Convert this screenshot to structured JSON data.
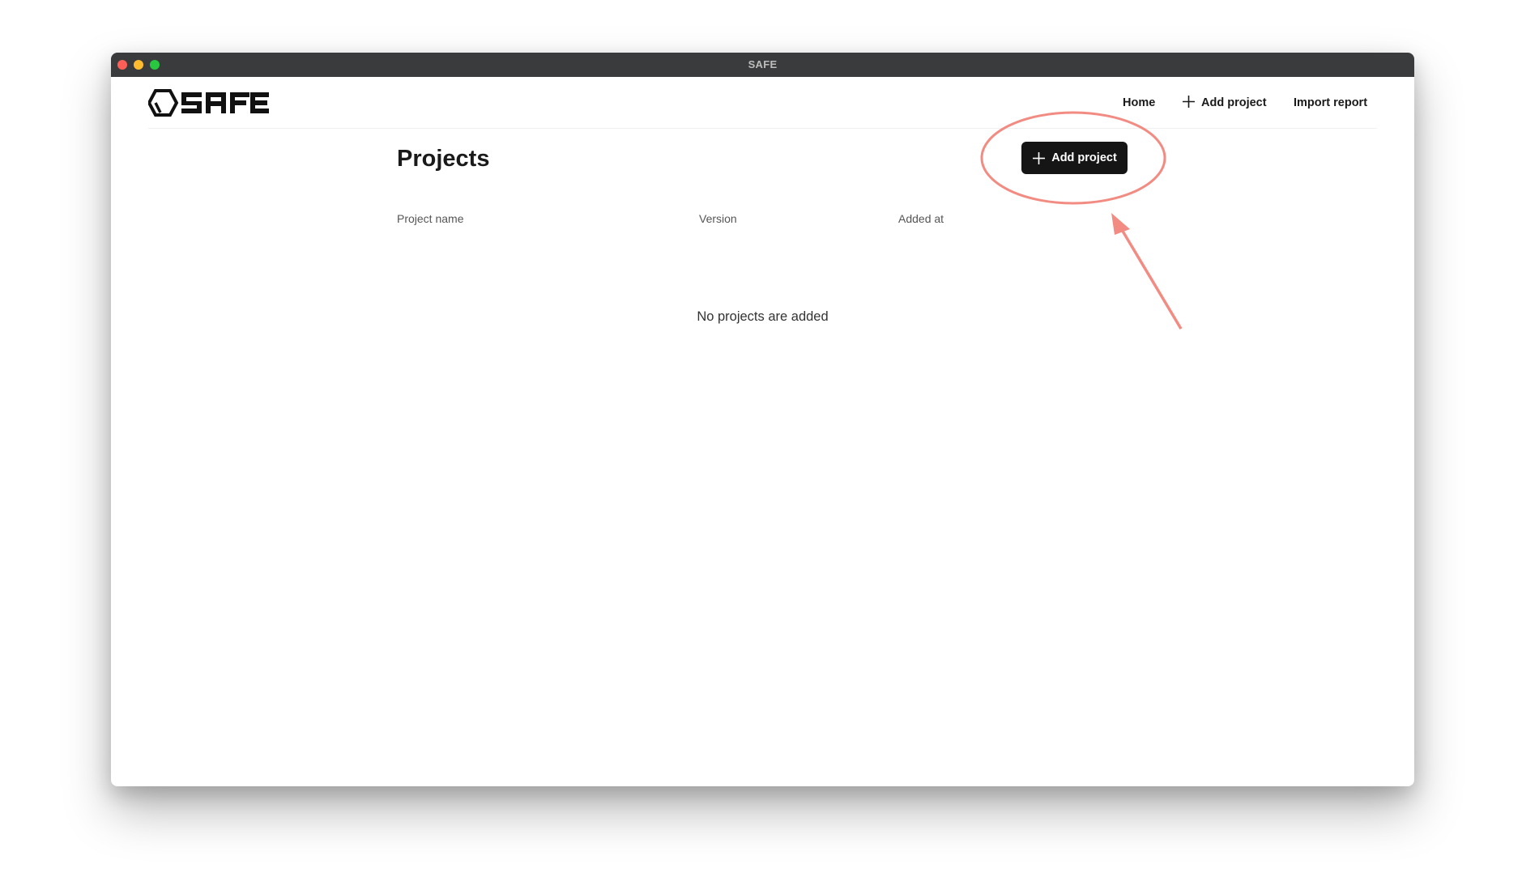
{
  "window": {
    "title": "SAFE"
  },
  "navbar": {
    "logo_text": "SAFE",
    "links": [
      {
        "label": "Home"
      },
      {
        "label": "Add project",
        "icon": "plus-icon"
      },
      {
        "label": "Import report"
      }
    ]
  },
  "main": {
    "title": "Projects",
    "add_button": {
      "label": "Add project",
      "icon": "plus-icon"
    },
    "table": {
      "columns": [
        "Project name",
        "Version",
        "Added at"
      ],
      "rows": []
    },
    "empty_message": "No projects are added"
  },
  "annotation": {
    "color": "#f28b82",
    "shape": "ellipse-with-arrow",
    "target": "add-project-button"
  },
  "colors": {
    "titlebar": "#3a3b3c",
    "button": "#151515",
    "traffic_red": "#ff5f57",
    "traffic_yellow": "#febc2e",
    "traffic_green": "#28c840"
  }
}
